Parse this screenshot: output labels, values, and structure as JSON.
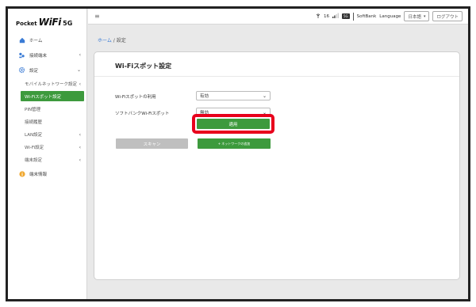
{
  "logo": {
    "pocket": "Pocket",
    "wifi": "WiFi",
    "five": "5G"
  },
  "sidebar": {
    "items": [
      {
        "label": "ホーム",
        "icon": "home-icon"
      },
      {
        "label": "接続端末",
        "icon": "devices-icon"
      },
      {
        "label": "設定",
        "icon": "gear-icon"
      }
    ],
    "sub_items": [
      {
        "label": "モバイルネットワーク設定"
      },
      {
        "label": "Wi-Fiスポット設定"
      },
      {
        "label": "PIN管理"
      },
      {
        "label": "接続履歴"
      },
      {
        "label": "LAN設定"
      },
      {
        "label": "Wi-Fi設定"
      },
      {
        "label": "端末設定"
      }
    ],
    "info": {
      "label": "端末情報",
      "icon": "info-icon"
    }
  },
  "topbar": {
    "signal_number": "16",
    "network_badge": "5G",
    "carrier": "SoftBank",
    "language_label": "Language",
    "language_value": "日本語",
    "logout": "ログアウト"
  },
  "breadcrumb": {
    "home": "ホーム",
    "separator": "/",
    "current": "設定"
  },
  "card": {
    "title": "Wi-Fiスポット設定",
    "rows": [
      {
        "label": "Wi-Fiスポットの利用",
        "value": "有効"
      },
      {
        "label": "ソフトバンクWi-Fiスポット",
        "value": "無効"
      }
    ],
    "apply": "適用",
    "scan": "スキャン",
    "add_network": "+ ネットワークの追加"
  },
  "colors": {
    "accent_green": "#3d9a3d",
    "highlight_red": "#e8001c",
    "link_blue": "#3a7bd5"
  }
}
